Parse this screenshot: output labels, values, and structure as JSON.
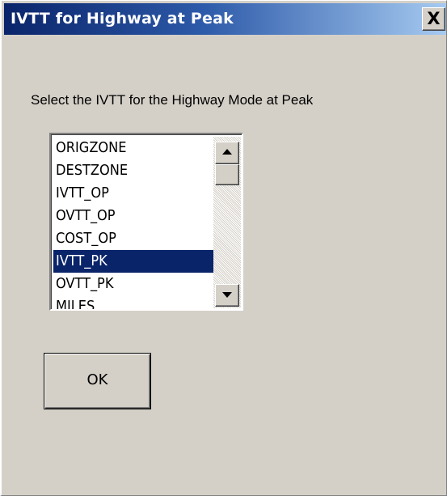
{
  "window": {
    "title": "IVTT for Highway at Peak",
    "close_label": "X"
  },
  "dialog": {
    "prompt": "Select the IVTT for the Highway Mode at Peak",
    "list": {
      "items": [
        "ORIGZONE",
        "DESTZONE",
        "IVTT_OP",
        "OVTT_OP",
        "COST_OP",
        "IVTT_PK",
        "OVTT_PK",
        "MILES"
      ],
      "selected": "IVTT_PK"
    },
    "ok_label": "OK"
  },
  "colors": {
    "window_bg": "#d4d0c8",
    "title_gradient_start": "#0a246a",
    "title_gradient_end": "#a6caf0",
    "selection_bg": "#0a246a",
    "selection_text": "#ffffff"
  },
  "icons": {
    "close": "close-icon",
    "scroll_up": "scroll-up-arrow-icon",
    "scroll_down": "scroll-down-arrow-icon"
  }
}
